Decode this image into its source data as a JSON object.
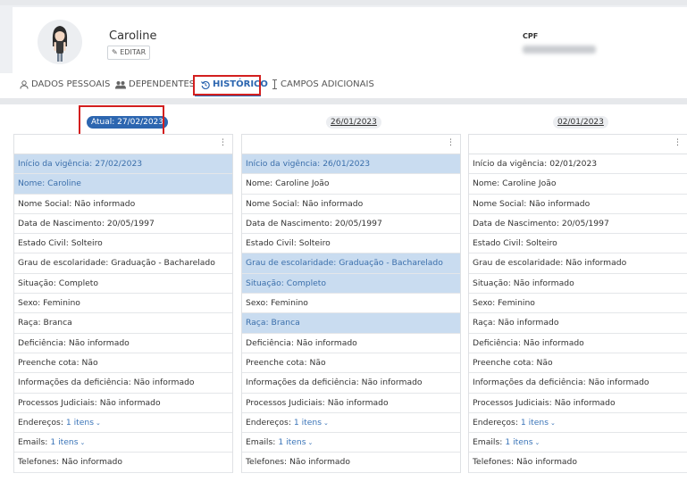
{
  "profile": {
    "name": "Caroline",
    "edit_label": "EDITAR",
    "cpf_label": "CPF"
  },
  "tabs": [
    {
      "label": "DADOS PESSOAIS",
      "icon": "user-icon",
      "active": false
    },
    {
      "label": "DEPENDENTES",
      "icon": "users-icon",
      "active": false
    },
    {
      "label": "HISTÓRICO",
      "icon": "history-icon",
      "active": true
    },
    {
      "label": "CAMPOS ADICIONAIS",
      "icon": "text-cursor-icon",
      "active": false
    }
  ],
  "colors": {
    "accent": "#2c66b0",
    "highlight": "#c9dcf0",
    "annotation": "#d31f1f"
  },
  "history": [
    {
      "date": "Atual: 27/02/2023",
      "current": true,
      "rows": [
        {
          "label": "Início da vigência",
          "value": "27/02/2023",
          "hl": true
        },
        {
          "label": "Nome",
          "value": "Caroline",
          "hl": true
        },
        {
          "label": "Nome Social",
          "value": "Não informado"
        },
        {
          "label": "Data de Nascimento",
          "value": "20/05/1997"
        },
        {
          "label": "Estado Civil",
          "value": "Solteiro"
        },
        {
          "label": "Grau de escolaridade",
          "value": "Graduação - Bacharelado"
        },
        {
          "label": "Situação",
          "value": "Completo"
        },
        {
          "label": "Sexo",
          "value": "Feminino"
        },
        {
          "label": "Raça",
          "value": "Branca"
        },
        {
          "label": "Deficiência",
          "value": "Não informado"
        },
        {
          "label": "Preenche cota",
          "value": "Não"
        },
        {
          "label": "Informações da deficiência",
          "value": "Não informado"
        },
        {
          "label": "Processos Judiciais",
          "value": "Não informado"
        },
        {
          "label": "Endereços",
          "value": "1 itens",
          "link": true
        },
        {
          "label": "Emails",
          "value": "1 itens",
          "link": true
        },
        {
          "label": "Telefones",
          "value": "Não informado"
        }
      ]
    },
    {
      "date": "26/01/2023",
      "current": false,
      "rows": [
        {
          "label": "Início da vigência",
          "value": "26/01/2023",
          "hl": true
        },
        {
          "label": "Nome",
          "value": "Caroline João"
        },
        {
          "label": "Nome Social",
          "value": "Não informado"
        },
        {
          "label": "Data de Nascimento",
          "value": "20/05/1997"
        },
        {
          "label": "Estado Civil",
          "value": "Solteiro"
        },
        {
          "label": "Grau de escolaridade",
          "value": "Graduação - Bacharelado",
          "hl": true
        },
        {
          "label": "Situação",
          "value": "Completo",
          "hl": true
        },
        {
          "label": "Sexo",
          "value": "Feminino"
        },
        {
          "label": "Raça",
          "value": "Branca",
          "hl": true
        },
        {
          "label": "Deficiência",
          "value": "Não informado"
        },
        {
          "label": "Preenche cota",
          "value": "Não"
        },
        {
          "label": "Informações da deficiência",
          "value": "Não informado"
        },
        {
          "label": "Processos Judiciais",
          "value": "Não informado"
        },
        {
          "label": "Endereços",
          "value": "1 itens",
          "link": true
        },
        {
          "label": "Emails",
          "value": "1 itens",
          "link": true
        },
        {
          "label": "Telefones",
          "value": "Não informado"
        }
      ]
    },
    {
      "date": "02/01/2023",
      "current": false,
      "rows": [
        {
          "label": "Início da vigência",
          "value": "02/01/2023"
        },
        {
          "label": "Nome",
          "value": "Caroline João"
        },
        {
          "label": "Nome Social",
          "value": "Não informado"
        },
        {
          "label": "Data de Nascimento",
          "value": "20/05/1997"
        },
        {
          "label": "Estado Civil",
          "value": "Solteiro"
        },
        {
          "label": "Grau de escolaridade",
          "value": "Não informado"
        },
        {
          "label": "Situação",
          "value": "Não informado"
        },
        {
          "label": "Sexo",
          "value": "Feminino"
        },
        {
          "label": "Raça",
          "value": "Não informado"
        },
        {
          "label": "Deficiência",
          "value": "Não informado"
        },
        {
          "label": "Preenche cota",
          "value": "Não"
        },
        {
          "label": "Informações da deficiência",
          "value": "Não informado"
        },
        {
          "label": "Processos Judiciais",
          "value": "Não informado"
        },
        {
          "label": "Endereços",
          "value": "1 itens",
          "link": true
        },
        {
          "label": "Emails",
          "value": "1 itens",
          "link": true
        },
        {
          "label": "Telefones",
          "value": "Não informado"
        }
      ]
    }
  ]
}
